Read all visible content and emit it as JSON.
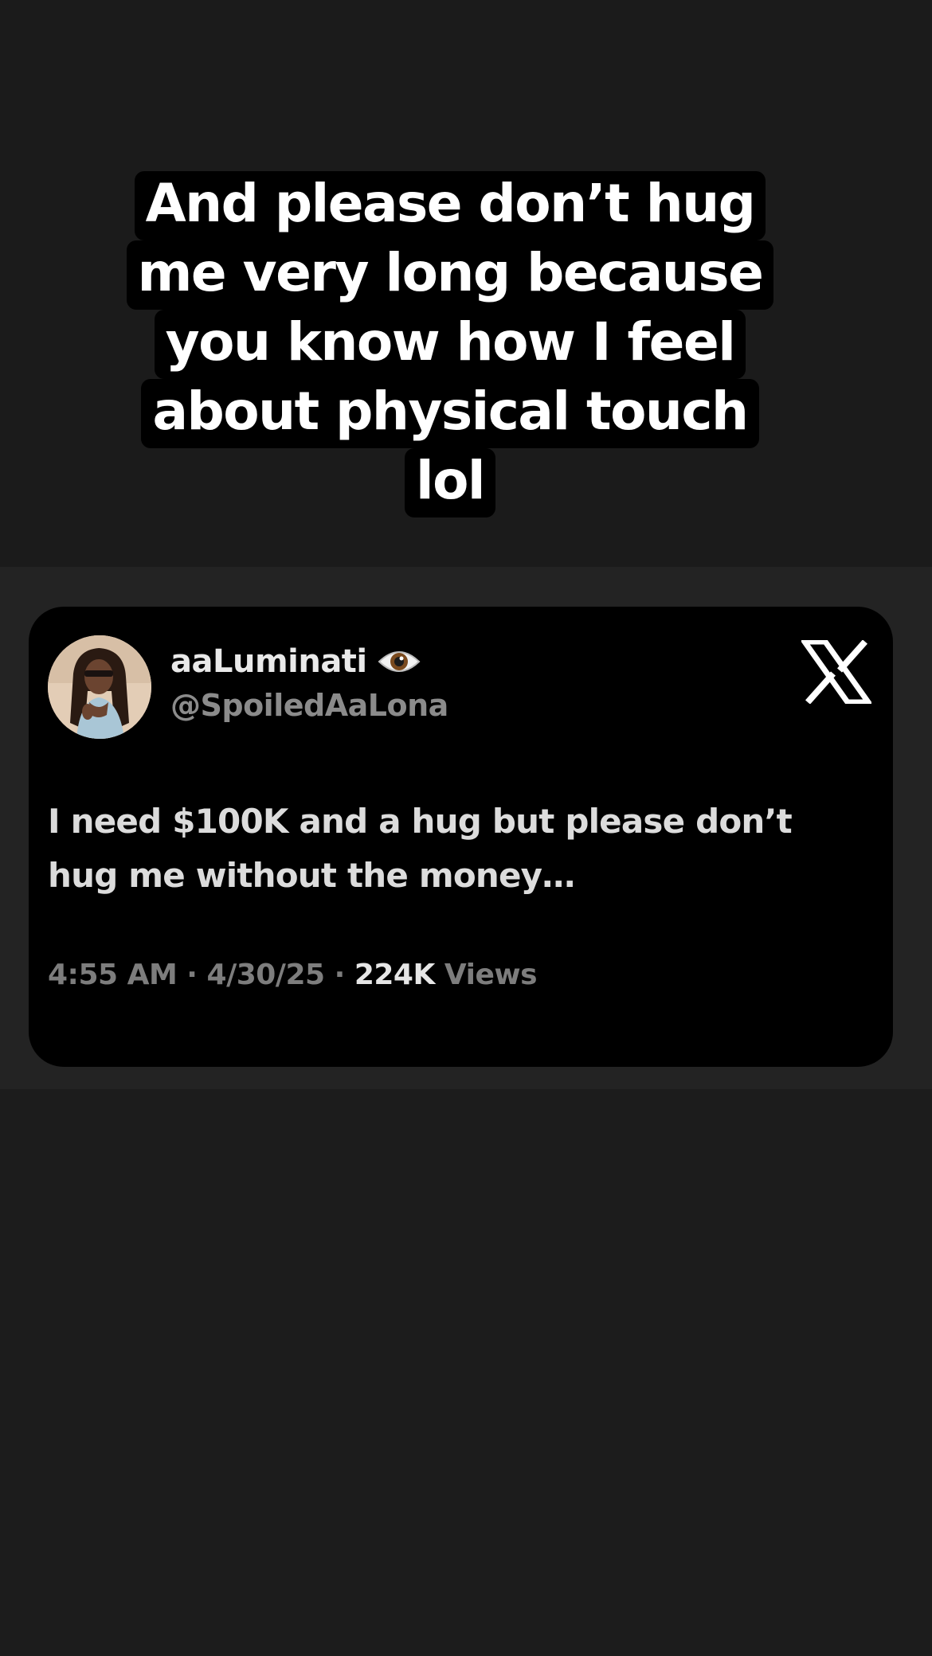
{
  "caption": {
    "line1": "And please don’t hug",
    "line2": "me very long because",
    "line3": "you know how I feel",
    "line4": "about physical touch",
    "line5": "lol"
  },
  "tweet": {
    "display_name": "aaLuminati",
    "handle": "@SpoiledAaLona",
    "text_line1": "I need $100K and a hug but please don’t",
    "text_line2": "hug me without the money…",
    "time": "4:55 AM",
    "separator": " · ",
    "date": "4/30/25",
    "views_count": "224K",
    "views_label": " Views",
    "badge_icon": "eye-emoji-icon",
    "platform_icon": "x-logo-icon"
  },
  "colors": {
    "background": "#1c1c1c",
    "band": "#232323",
    "card": "#000000",
    "caption_bg": "#000000",
    "caption_text": "#ffffff",
    "muted_text": "#7d7d7d"
  }
}
